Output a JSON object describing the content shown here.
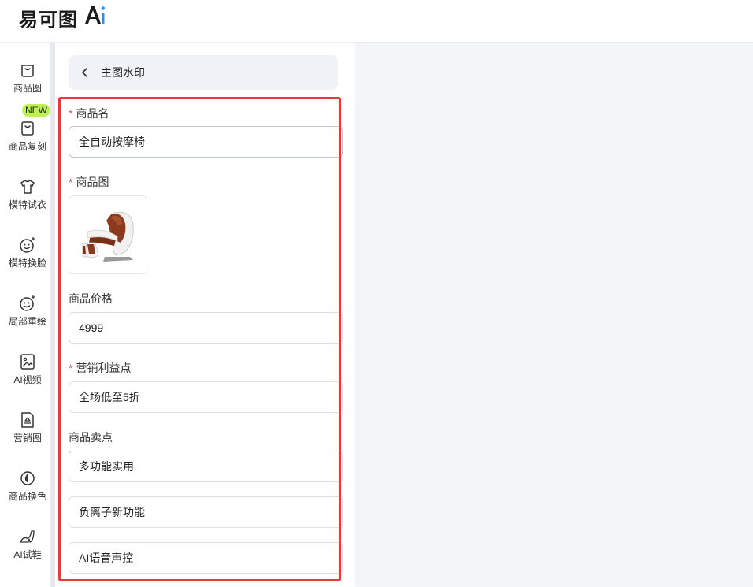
{
  "brand": {
    "name": "易可图",
    "ai_mark": "Ai",
    "accent": "#2e8cf7"
  },
  "sidebar": {
    "new_badge": "NEW",
    "items": [
      {
        "label": "商品图",
        "icon": "bag-icon"
      },
      {
        "label": "商品复刻",
        "icon": "bag-copy-icon"
      },
      {
        "label": "模特试衣",
        "icon": "tshirt-icon"
      },
      {
        "label": "模特换脸",
        "icon": "face-sparkle-icon"
      },
      {
        "label": "局部重绘",
        "icon": "face-sparkle-icon"
      },
      {
        "label": "AI视频",
        "icon": "video-image-icon"
      },
      {
        "label": "营销图",
        "icon": "marketing-doc-icon"
      },
      {
        "label": "商品换色",
        "icon": "color-drop-icon"
      },
      {
        "label": "AI试鞋",
        "icon": "high-heel-icon"
      }
    ]
  },
  "panel": {
    "title": "主图水印",
    "fields": {
      "product_name": {
        "label": "商品名",
        "required": true,
        "value": "全自动按摩椅"
      },
      "product_image": {
        "label": "商品图",
        "required": true,
        "image": "massage-chair-thumbnail"
      },
      "price": {
        "label": "商品价格",
        "required": false,
        "value": "4999"
      },
      "marketing": {
        "label": "营销利益点",
        "required": true,
        "value": "全场低至5折"
      },
      "selling_points": {
        "label": "商品卖点",
        "required": false,
        "values": [
          "多功能实用",
          "负离子新功能",
          "AI语音声控"
        ]
      }
    },
    "highlight_color": "#e43b3b"
  }
}
